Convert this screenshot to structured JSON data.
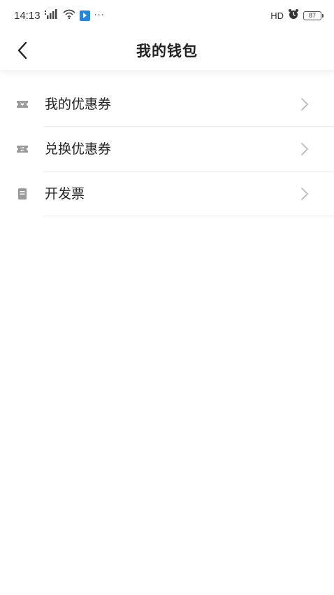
{
  "status_bar": {
    "time": "14:13",
    "more": "···",
    "hd": "HD",
    "battery": "87"
  },
  "header": {
    "title": "我的钱包"
  },
  "menu": {
    "items": [
      {
        "label": "我的优惠券",
        "icon": "coupon-icon"
      },
      {
        "label": "兑换优惠券",
        "icon": "exchange-coupon-icon"
      },
      {
        "label": "开发票",
        "icon": "invoice-icon"
      }
    ]
  },
  "colors": {
    "icon_gray": "#9a9a9a",
    "chevron_gray": "#b5b5b5",
    "divider": "#e8e8e8",
    "app_badge_blue": "#1e88e5"
  }
}
